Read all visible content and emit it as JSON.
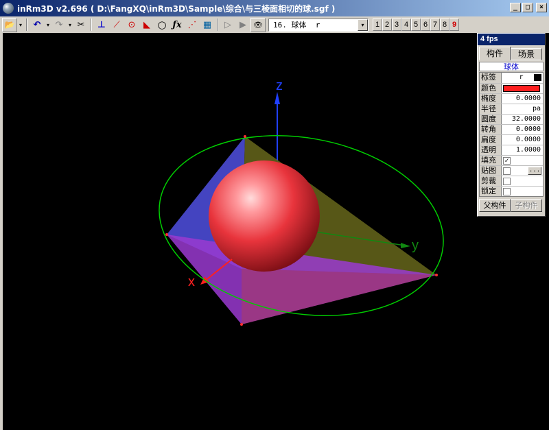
{
  "window": {
    "title": "inRm3D v2.696 ( D:\\FangXQ\\inRm3D\\Sample\\综合\\与三棱面相切的球.sgf )",
    "minimize": "_",
    "maximize": "□",
    "close": "×"
  },
  "toolbar": {
    "open_icon": "📂",
    "dropdown": "▾",
    "undo_icon": "↶",
    "redo_icon": "↷",
    "cut_icon": "✂",
    "axes_icon": "⊥",
    "line_icon": "⟋",
    "circle_point_icon": "⊙",
    "plane_icon": "◣",
    "circle_icon": "○",
    "function_icon": "ƒx",
    "points_icon": "⋰",
    "calc_icon": "▦",
    "play_icon": "▷",
    "step_icon": "▶",
    "view_icon": "👁",
    "object_select": "16. 球体  r",
    "layers": [
      "1",
      "2",
      "3",
      "4",
      "5",
      "6",
      "7",
      "8",
      "9"
    ],
    "active_layer": "9"
  },
  "scene": {
    "axis_x": "x",
    "axis_y": "y",
    "axis_z": "z",
    "colors": {
      "sphere": "#e8343c",
      "ellipse": "#00cc00",
      "x_axis": "#ff2020",
      "y_axis": "#118811",
      "z_axis": "#2040ff",
      "face_blue": "#4a4ad0",
      "face_olive": "#5c5c18",
      "face_purple": "#9a3ad0"
    }
  },
  "panel": {
    "fps": "4 fps",
    "tab_objects": "构件",
    "tab_scene": "场景",
    "object_name": "球体",
    "props": [
      {
        "label": "标签",
        "value": "r"
      },
      {
        "label": "颜色",
        "value": ""
      },
      {
        "label": "椭度",
        "value": "0.0000"
      },
      {
        "label": "半径",
        "value": "pa"
      },
      {
        "label": "圆度",
        "value": "32.0000"
      },
      {
        "label": "转角",
        "value": "0.0000"
      },
      {
        "label": "扁度",
        "value": "0.0000"
      },
      {
        "label": "透明",
        "value": "1.0000"
      },
      {
        "label": "填充",
        "value": "✓"
      },
      {
        "label": "贴图",
        "value": "..."
      },
      {
        "label": "剪裁",
        "value": ""
      },
      {
        "label": "锁定",
        "value": ""
      }
    ],
    "parent_button": "父构件",
    "child_button": "子构件"
  }
}
